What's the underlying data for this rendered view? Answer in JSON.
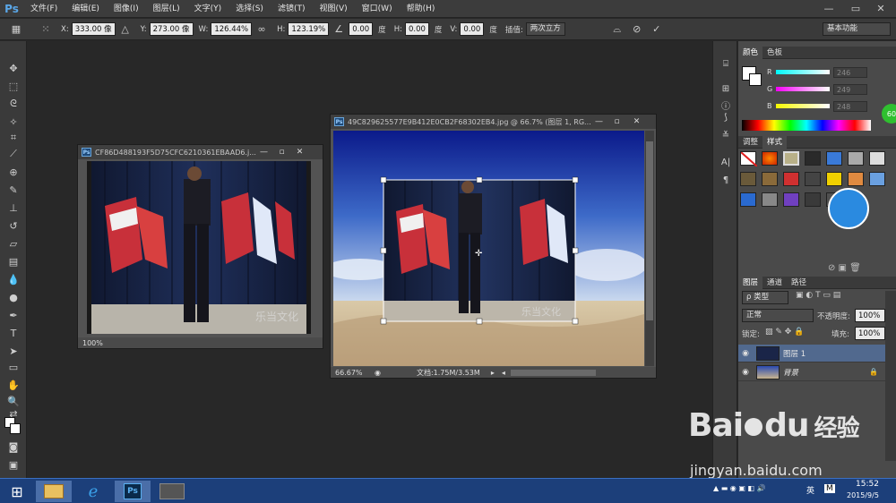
{
  "app": {
    "logo": "Ps"
  },
  "menubar": {
    "items": [
      "文件(F)",
      "编辑(E)",
      "图像(I)",
      "图层(L)",
      "文字(Y)",
      "选择(S)",
      "滤镜(T)",
      "视图(V)",
      "窗口(W)",
      "帮助(H)"
    ],
    "window_controls": [
      "—",
      "▭",
      "✕"
    ]
  },
  "options": {
    "x_label": "X:",
    "x_value": "333.00 像",
    "y_label": "Y:",
    "y_value": "273.00 像",
    "w_label": "W:",
    "w_value": "126.44%",
    "h_label": "H:",
    "h_value": "123.19%",
    "angle_value": "0.00",
    "angle_unit": "度",
    "hskew_label": "H:",
    "hskew_value": "0.00",
    "hskew_unit": "度",
    "vskew_label": "V:",
    "vskew_value": "0.00",
    "vskew_unit": "度",
    "interp_label": "插值:",
    "interp_value": "两次立方",
    "workspace": "基本功能"
  },
  "docs": {
    "left": {
      "title": "CF86D488193F5D75CFC6210361EBAAD6.j...",
      "zoom": "100%",
      "watermark": "乐当文化"
    },
    "right": {
      "title": "49C829625577E9B412E0CB2F68302EB4.jpg @ 66.7% (图层 1, RG...",
      "zoom": "66.67%",
      "status": "文档:1.75M/3.53M",
      "watermark": "乐当文化"
    }
  },
  "color_panel": {
    "tabs": [
      "颜色",
      "色板"
    ],
    "channels": [
      {
        "label": "R",
        "value": "246"
      },
      {
        "label": "G",
        "value": "249"
      },
      {
        "label": "B",
        "value": "248"
      }
    ],
    "badge": "60"
  },
  "styles_panel": {
    "tabs": [
      "调整",
      "样式"
    ]
  },
  "layers_panel": {
    "tabs": [
      "图层",
      "通道",
      "路径"
    ],
    "filter_label": "ρ 类型",
    "blend_mode": "正常",
    "opacity_label": "不透明度:",
    "opacity_value": "100%",
    "lock_label": "锁定:",
    "fill_label": "填充:",
    "fill_value": "100%",
    "layers": [
      {
        "name": "图层 1",
        "selected": true
      },
      {
        "name": "背景",
        "selected": false
      }
    ]
  },
  "taskbar": {
    "ime": "英",
    "time": "15:52",
    "date": "2015/9/5"
  },
  "overlay": {
    "baidu_logo_text": "Bai",
    "baidu_logo_text2": "du",
    "jingyan": "经验",
    "url": "jingyan.baidu.com"
  },
  "colors": {
    "accent": "#5aa7e8",
    "taskbar": "#1c3f7a"
  }
}
